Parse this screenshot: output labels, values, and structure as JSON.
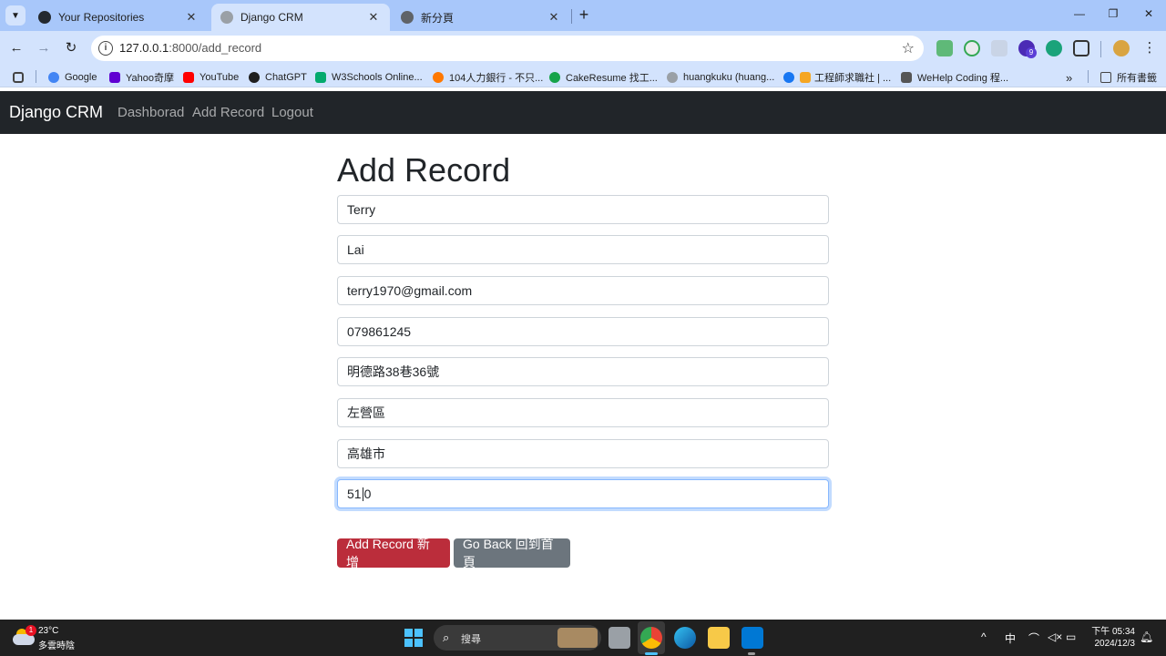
{
  "browser": {
    "tabs": [
      {
        "title": "Your Repositories",
        "active": false
      },
      {
        "title": "Django CRM",
        "active": true
      },
      {
        "title": "新分頁",
        "active": false
      }
    ],
    "url_host": "127.0.0.1",
    "url_rest": ":8000/add_record",
    "extension_badge": "9",
    "bookmarks": [
      "Google",
      "Yahoo奇摩",
      "YouTube",
      "ChatGPT",
      "W3Schools Online...",
      "104人力銀行 - 不只...",
      "CakeResume 找工...",
      "huangkuku (huang...",
      "工程師求職社 | ...",
      "WeHelp Coding 程..."
    ],
    "all_bookmarks": "所有書籤"
  },
  "navbar": {
    "brand": "Django CRM",
    "links": [
      "Dashborad",
      "Add Record",
      "Logout"
    ]
  },
  "form": {
    "title": "Add Record",
    "first_name": "Terry",
    "last_name": "Lai",
    "email": "terry1970@gmail.com",
    "phone": "079861245",
    "address": "明德路38巷36號",
    "city": "左營區",
    "state": "高雄市",
    "zipcode_before_caret": "51",
    "zipcode_after_caret": "0",
    "submit_label": "Add Record 新增",
    "back_label": "Go Back 回到首頁"
  },
  "taskbar": {
    "weather_badge": "1",
    "temperature": "23°C",
    "weather": "多雲時陰",
    "search_placeholder": "搜尋",
    "ime": "中",
    "time": "下午 05:34",
    "date": "2024/12/3"
  },
  "colors": {
    "tabbar": "#a8c7fa",
    "toolbar": "#d3e3fd",
    "navbar": "#212529",
    "danger": "#bb2d3b",
    "secondary": "#6c757d",
    "focus_ring": "#86b7fe"
  }
}
